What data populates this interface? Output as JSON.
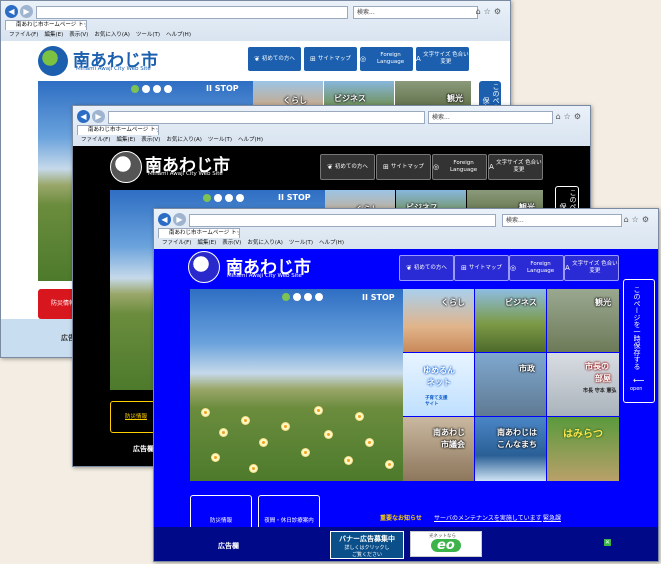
{
  "browser": {
    "search_placeholder": "検索...",
    "tab_title": "南あわじ市ホームページ トップ...",
    "menu": [
      "ファイル(F)",
      "編集(E)",
      "表示(V)",
      "お気に入り(A)",
      "ツール(T)",
      "ヘルプ(H)"
    ]
  },
  "site": {
    "title": "南あわじ市",
    "subtitle": "Minami Awaji City Web Site",
    "nav": [
      {
        "label": "初めての方へ",
        "icon": "leaf-icon"
      },
      {
        "label": "サイトマップ",
        "icon": "sitemap-icon"
      },
      {
        "label": "Foreign Language",
        "icon": "globe-icon"
      },
      {
        "label": "文字サイズ 色合い変更",
        "icon": "text-size-icon"
      }
    ],
    "slider_stop": "II STOP",
    "tiles": {
      "kurashi": "くらし",
      "business": "ビジネス",
      "kanko": "観光",
      "yumerun_1": "ゆめるん",
      "yumerun_2": "ネット",
      "yumerun_sub": "子育て支援サイト",
      "shisei": "市政",
      "mayor_1": "市長の",
      "mayor_2": "部屋",
      "mayor_name": "市長 守本 憲弘",
      "council_1": "南あわじ",
      "council_2": "市議会",
      "konna_1": "南あわじは",
      "konna_2": "こんなまち",
      "hamisetsu": "はみらつ"
    },
    "side_tab": "このページを一時保存する",
    "side_tab_open": "open",
    "bosai": "防災情報",
    "kyujitsu": "夜間・休日診療案内",
    "important_label": "重要なお知らせ",
    "important_text": "サーバのメンテナンスを実施しています",
    "kinkyu": "緊急課",
    "ad_label": "広告欄",
    "banner_title": "バナー広告募集中",
    "banner_sub1": "詳しくはクリックし",
    "banner_sub2": "ご覧ください",
    "eo_top": "光ネットなら",
    "eo_logo": "eo"
  },
  "colors": {
    "back_theme": "#ffffff",
    "mid_theme": "#000000",
    "front_theme": "#0000ff",
    "nav_white_theme": "#1b5fae",
    "accent_gold": "#ffd000"
  }
}
